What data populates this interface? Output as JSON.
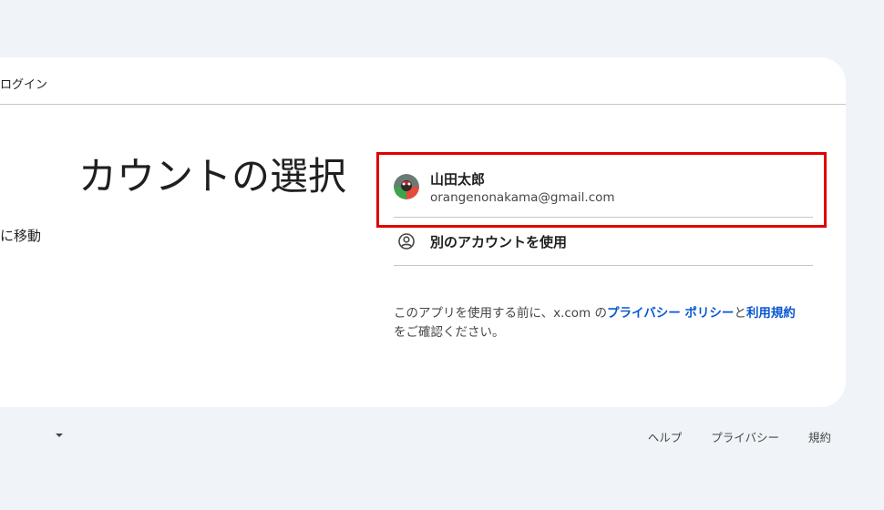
{
  "header": {
    "title": "ログイン"
  },
  "main": {
    "heading": "カウントの選択",
    "subtext": "に移動"
  },
  "accounts": [
    {
      "name": "山田太郎",
      "email": "orangenonakama@gmail.com",
      "avatar_icon": "user-avatar-icon"
    }
  ],
  "other_account": {
    "label": "別のアカウントを使用",
    "icon": "account-circle-icon"
  },
  "disclaimer": {
    "prefix": "このアプリを使用する前に、x.com の",
    "privacy_link": "プライバシー ポリシー",
    "middle": "と",
    "terms_link": "利用規約",
    "suffix": "をご確認ください。"
  },
  "footer": {
    "help": "ヘルプ",
    "privacy": "プライバシー",
    "terms": "規約"
  },
  "colors": {
    "background": "#f0f4f9",
    "link": "#0b57d0",
    "highlight": "#e00000"
  }
}
